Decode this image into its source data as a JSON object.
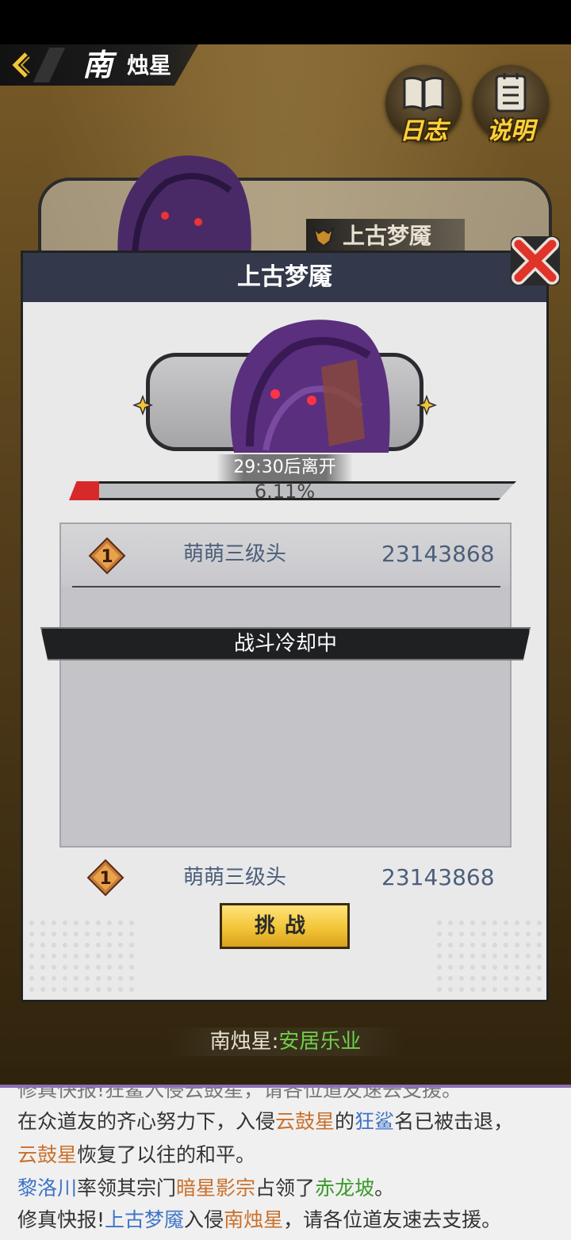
{
  "header": {
    "region_big": "南",
    "region_small": "烛星",
    "log_button": "日志",
    "help_button": "说明"
  },
  "background_card": {
    "boss_name": "上古梦魇"
  },
  "modal": {
    "title": "上古梦魇",
    "timer_text": "29:30后离开",
    "hp_percent_text": "6.11%",
    "hp_fraction": 0.0611,
    "ranking_top": {
      "rank": "1",
      "name": "萌萌三级头",
      "score": "23143868"
    },
    "cooldown_text": "战斗冷却中",
    "my_rank": {
      "rank": "1",
      "name": "萌萌三级头",
      "score": "23143868"
    },
    "challenge_button": "挑战"
  },
  "status": {
    "planet": "南烛星:",
    "state": "安居乐业"
  },
  "news": {
    "line0": "修真快报!狂鲨入侵云鼓星，请各位道友速去支援。",
    "line1": {
      "a": "在众道友的齐心努力下，入侵",
      "b": "云鼓星",
      "c": "的",
      "d": "狂鲨",
      "e": "名已被击退，"
    },
    "line2": {
      "a": "云鼓星",
      "b": "恢复了以往的和平。"
    },
    "line3": {
      "a": "黎洛川",
      "b": "率领其宗门",
      "c": "暗星影宗",
      "d": "占领了",
      "e": "赤龙坡",
      "f": "。"
    },
    "line4": {
      "a": "修真快报!",
      "b": "上古梦魇",
      "c": "入侵",
      "d": "南烛星",
      "e": "，请各位道友速去支援。"
    }
  },
  "colors": {
    "modal_header": "#33384a",
    "hp_fill": "#d8292a",
    "name_text": "#4b5f7a",
    "accent_gold": "#f2c538",
    "news_blue": "#3d74c7",
    "news_orange": "#c9702b",
    "news_green": "#3a9a2a"
  }
}
